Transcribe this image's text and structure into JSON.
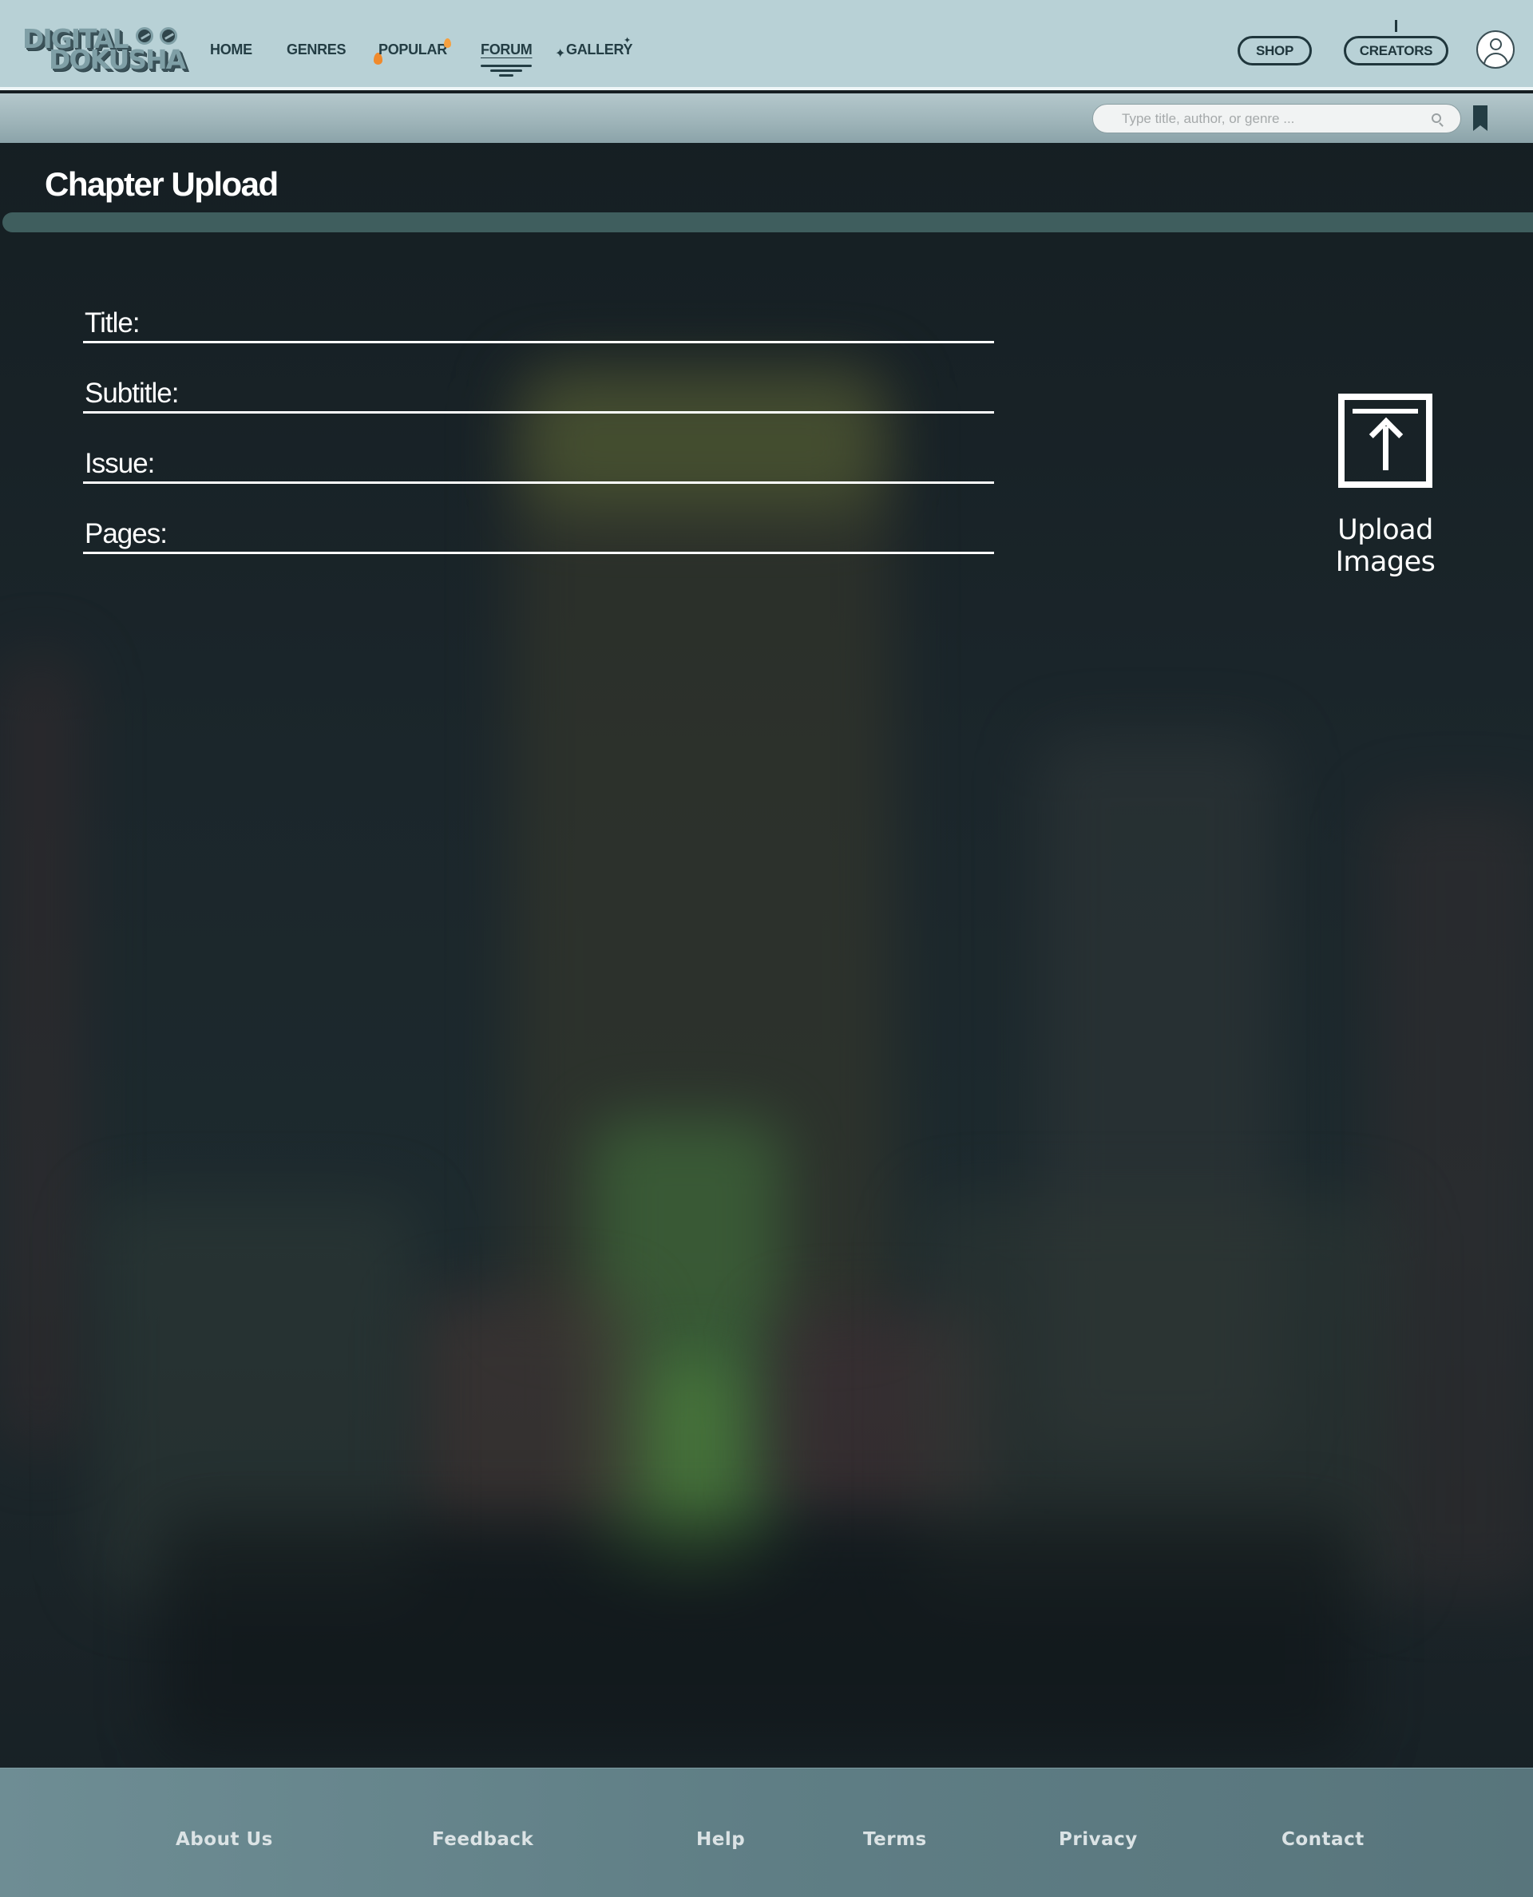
{
  "brand": {
    "line1": "DIGITAL",
    "line2": "DOKUSHA"
  },
  "nav": {
    "home": "HOME",
    "genres": "GENRES",
    "popular": "POPULAR",
    "forum": "FORUM",
    "gallery": "GALLERY"
  },
  "header_actions": {
    "shop": "SHOP",
    "creators": "CREATORS"
  },
  "search": {
    "placeholder": "Type title, author, or genre ..."
  },
  "page": {
    "title": "Chapter Upload"
  },
  "form": {
    "title_label": "Title:",
    "subtitle_label": "Subtitle:",
    "issue_label": "Issue:",
    "pages_label": "Pages:"
  },
  "upload": {
    "label": "Upload Images"
  },
  "footer": {
    "about": "About Us",
    "feedback": "Feedback",
    "help": "Help",
    "terms": "Terms",
    "privacy": "Privacy",
    "contact": "Contact"
  },
  "colors": {
    "header_bg": "#b8d1d6",
    "accent_dark": "#233d44",
    "progress": "#3f5e5e",
    "footer_bg": "#5f7e85",
    "flame": "#f08a2c"
  }
}
